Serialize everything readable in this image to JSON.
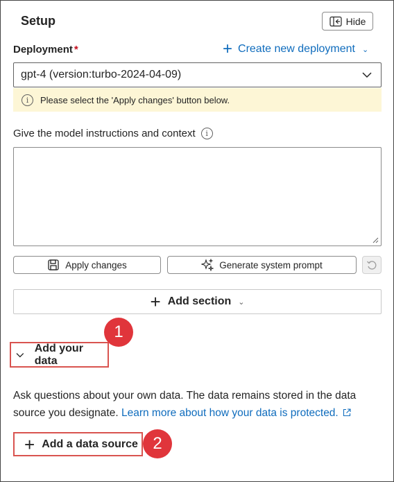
{
  "header": {
    "title": "Setup",
    "hide_label": "Hide"
  },
  "deployment": {
    "label": "Deployment",
    "required_mark": "*",
    "create_label": "Create new deployment",
    "selected": "gpt-4 (version:turbo-2024-04-09)"
  },
  "notice": {
    "text": "Please select the 'Apply changes' button below."
  },
  "instructions": {
    "label": "Give the model instructions and context",
    "value": ""
  },
  "actions": {
    "apply_label": "Apply changes",
    "generate_label": "Generate system prompt"
  },
  "add_section": {
    "label": "Add section"
  },
  "your_data": {
    "label": "Add your data",
    "description": "Ask questions about your own data. The data remains stored in the data source you designate.",
    "link_text": "Learn more about how your data is protected.",
    "add_source_label": "Add a data source"
  },
  "callouts": {
    "badge1": "1",
    "badge2": "2"
  },
  "colors": {
    "accent": "#0f6cbd",
    "callout": "#e0353b",
    "warning_bg": "#fdf6d6"
  }
}
